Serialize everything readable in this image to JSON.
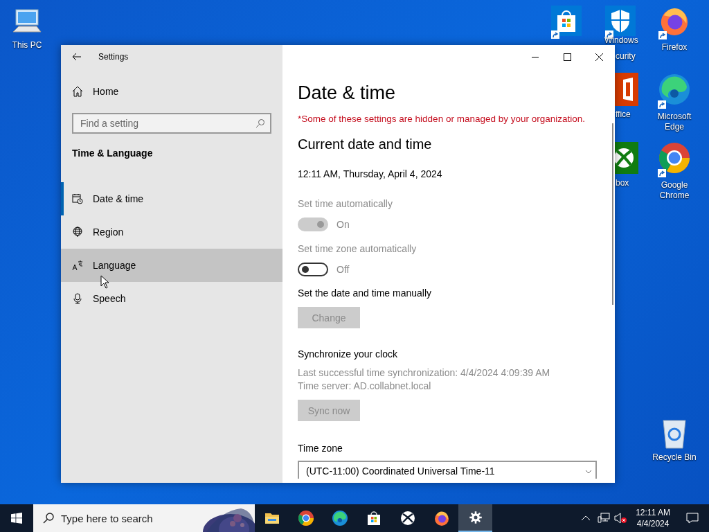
{
  "desktop_icons": [
    {
      "kind": "pc",
      "label": [
        "This PC"
      ]
    },
    {
      "kind": "store"
    },
    {
      "kind": "security",
      "label": [
        "Windows",
        "curity"
      ]
    },
    {
      "kind": "firefox",
      "label": [
        "Firefox"
      ]
    },
    {
      "kind": "office",
      "label": [
        "ffice"
      ]
    },
    {
      "kind": "edge",
      "label": [
        "Microsoft",
        "Edge"
      ]
    },
    {
      "kind": "xbox",
      "label": [
        "box"
      ]
    },
    {
      "kind": "chrome",
      "label": [
        "Google",
        "Chrome"
      ]
    },
    {
      "kind": "recycle",
      "label": [
        "Recycle Bin"
      ]
    }
  ],
  "window": {
    "title": "Settings",
    "sidebar": {
      "home": "Home",
      "search_placeholder": "Find a setting",
      "section": "Time & Language",
      "items": [
        {
          "kind": "calendar",
          "label": "Date & time",
          "selected": true,
          "hovered": false
        },
        {
          "kind": "globe",
          "label": "Region",
          "selected": false,
          "hovered": false
        },
        {
          "kind": "language",
          "label": "Language",
          "selected": false,
          "hovered": true
        },
        {
          "kind": "mic",
          "label": "Speech",
          "selected": false,
          "hovered": false
        }
      ]
    },
    "content": {
      "title": "Date & time",
      "notice": "*Some of these settings are hidden or managed by your organization.",
      "section": "Current date and time",
      "current": "12:11 AM, Thursday, April 4, 2024",
      "toggles": [
        {
          "label": "Set time automatically",
          "on": true,
          "disabled": true,
          "state_text": "On"
        },
        {
          "label": "Set time zone automatically",
          "on": false,
          "disabled": false,
          "state_text": "Off"
        }
      ],
      "manual": {
        "label": "Set the date and time manually",
        "button": "Change",
        "disabled": true
      },
      "sync": {
        "title": "Synchronize your clock",
        "last": "Last successful time synchronization: 4/4/2024 4:09:39 AM",
        "server": "Time server: AD.collabnet.local",
        "button": "Sync now",
        "disabled": true
      },
      "timezone": {
        "label": "Time zone",
        "value": "(UTC-11:00) Coordinated Universal Time-11"
      }
    }
  },
  "taskbar": {
    "search_placeholder": "Type here to search",
    "apps": [
      {
        "kind": "explorer",
        "selected": false
      },
      {
        "kind": "chrome",
        "selected": false
      },
      {
        "kind": "edge",
        "selected": false
      },
      {
        "kind": "store",
        "selected": false
      },
      {
        "kind": "xbox",
        "selected": false
      },
      {
        "kind": "firefox",
        "selected": false
      },
      {
        "kind": "settings",
        "selected": true
      }
    ],
    "time": "12:11 AM",
    "date": "4/4/2024"
  }
}
